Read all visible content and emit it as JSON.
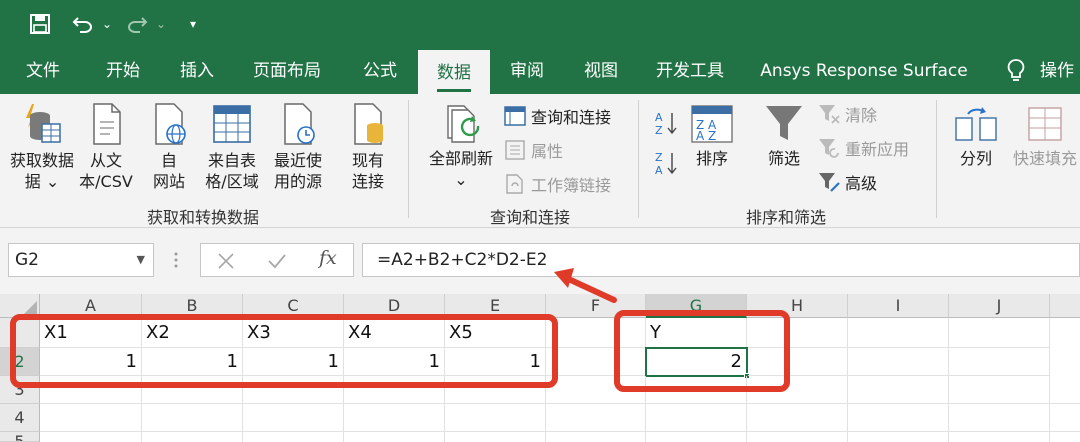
{
  "tabs": [
    "文件",
    "开始",
    "插入",
    "页面布局",
    "公式",
    "数据",
    "审阅",
    "视图",
    "开发工具",
    "Ansys Response Surface",
    "操作"
  ],
  "ribbon": {
    "get_data": "获取数据",
    "get_data_l2": "据",
    "from_text": "从文",
    "from_text_l2": "本/CSV",
    "from_web": "自",
    "from_web_l2": "网站",
    "from_table": "来自表",
    "from_table_l2": "格/区域",
    "recent": "最近使",
    "recent_l2": "用的源",
    "existing": "现有",
    "existing_l2": "连接",
    "group1": "获取和转换数据",
    "refresh_all": "全部刷新",
    "queries_connections": "查询和连接",
    "properties": "属性",
    "workbook_links": "工作簿链接",
    "group2": "查询和连接",
    "sort": "排序",
    "filter": "筛选",
    "clear": "清除",
    "reapply": "重新应用",
    "advanced": "高级",
    "group3": "排序和筛选",
    "split": "分列",
    "flash_fill": "快速填充"
  },
  "formula_bar": {
    "name_box": "G2",
    "formula": "=A2+B2+C2*D2-E2"
  },
  "columns": [
    "A",
    "B",
    "C",
    "D",
    "E",
    "F",
    "G",
    "H",
    "I",
    "J"
  ],
  "rows": [
    "2",
    "3",
    "4",
    "5"
  ],
  "cells": {
    "A1": "X1",
    "B1": "X2",
    "C1": "X3",
    "D1": "X4",
    "E1": "X5",
    "G1": "Y",
    "A2": "1",
    "B2": "1",
    "C2": "1",
    "D2": "1",
    "E2": "1",
    "G2": "2"
  },
  "colors": {
    "excel_green": "#217346",
    "annotation_red": "#e03a28"
  }
}
